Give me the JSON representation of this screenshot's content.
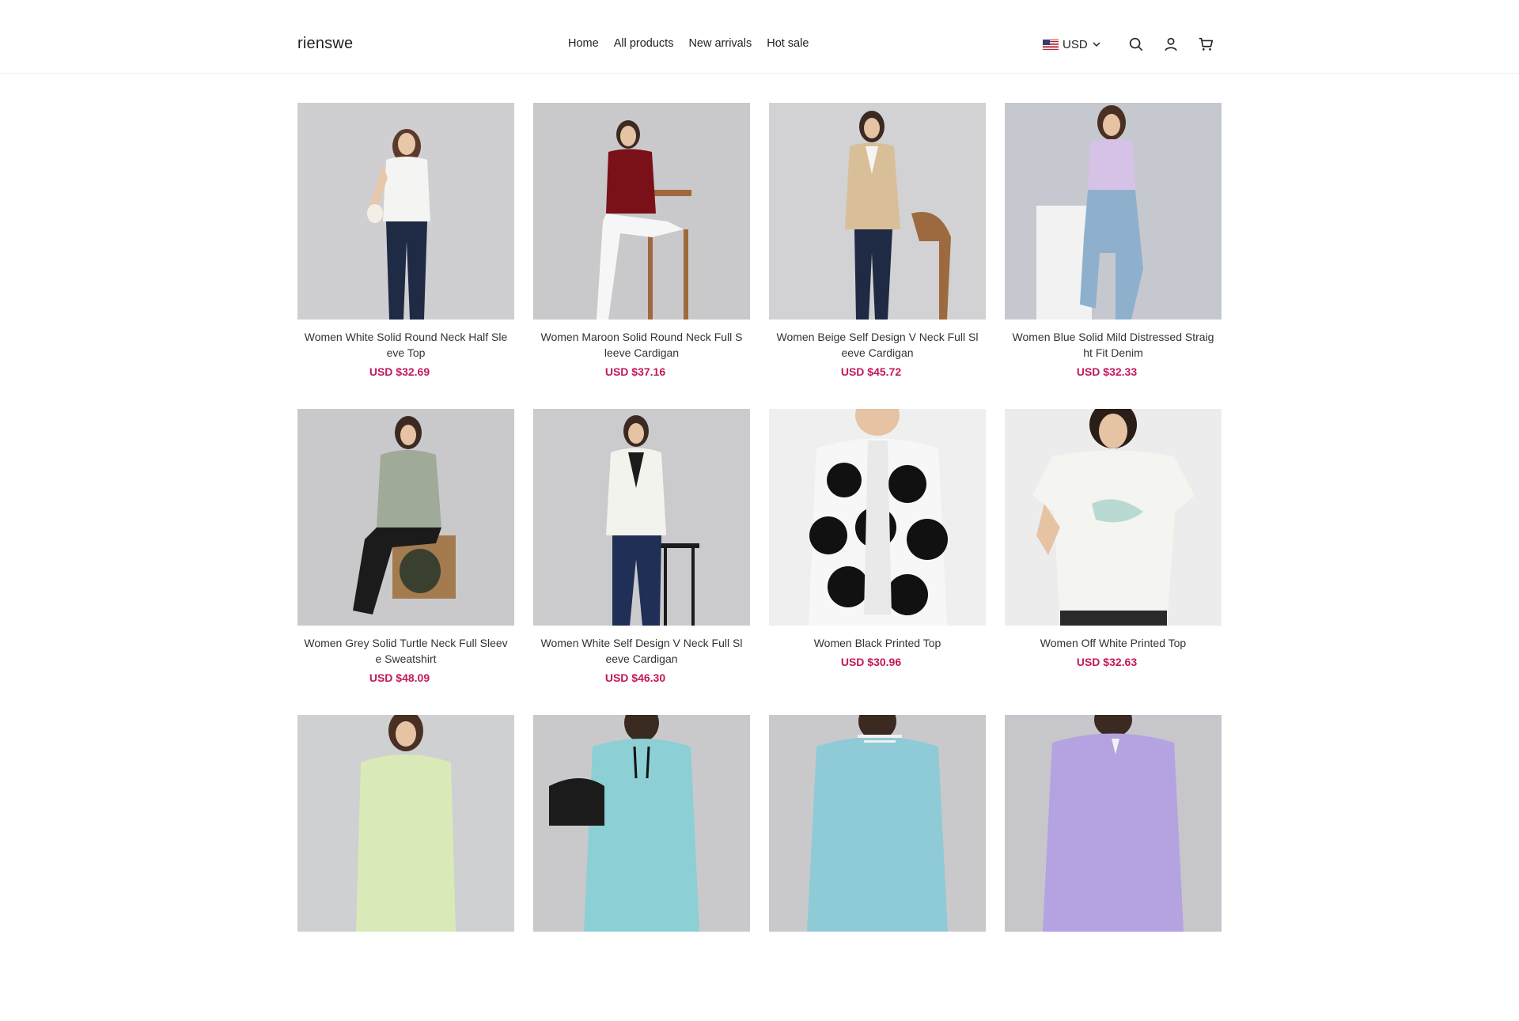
{
  "brand": "rienswe",
  "nav": [
    "Home",
    "All products",
    "New arrivals",
    "Hot sale"
  ],
  "currency": "USD",
  "colors": {
    "price": "#c2185b",
    "text": "#222222"
  },
  "icons": [
    "us-flag-icon",
    "chevron-down-icon",
    "search-icon",
    "user-icon",
    "cart-icon"
  ],
  "products": [
    {
      "title": "Women White Solid Round Neck Half Sleeve Top",
      "price": "USD $32.69"
    },
    {
      "title": "Women Maroon Solid Round Neck Full Sleeve Cardigan",
      "price": "USD $37.16"
    },
    {
      "title": "Women Beige Self Design V Neck Full Sleeve Cardigan",
      "price": "USD $45.72"
    },
    {
      "title": "Women Blue Solid Mild Distressed Straight Fit Denim",
      "price": "USD $32.33"
    },
    {
      "title": "Women Grey Solid Turtle Neck Full Sleeve Sweatshirt",
      "price": "USD $48.09"
    },
    {
      "title": "Women White Self Design V Neck Full Sleeve Cardigan",
      "price": "USD $46.30"
    },
    {
      "title": "Women Black Printed Top",
      "price": "USD $30.96"
    },
    {
      "title": "Women Off White Printed Top",
      "price": "USD $32.63"
    },
    {
      "title": "",
      "price": ""
    },
    {
      "title": "",
      "price": ""
    },
    {
      "title": "",
      "price": ""
    },
    {
      "title": "",
      "price": ""
    }
  ]
}
